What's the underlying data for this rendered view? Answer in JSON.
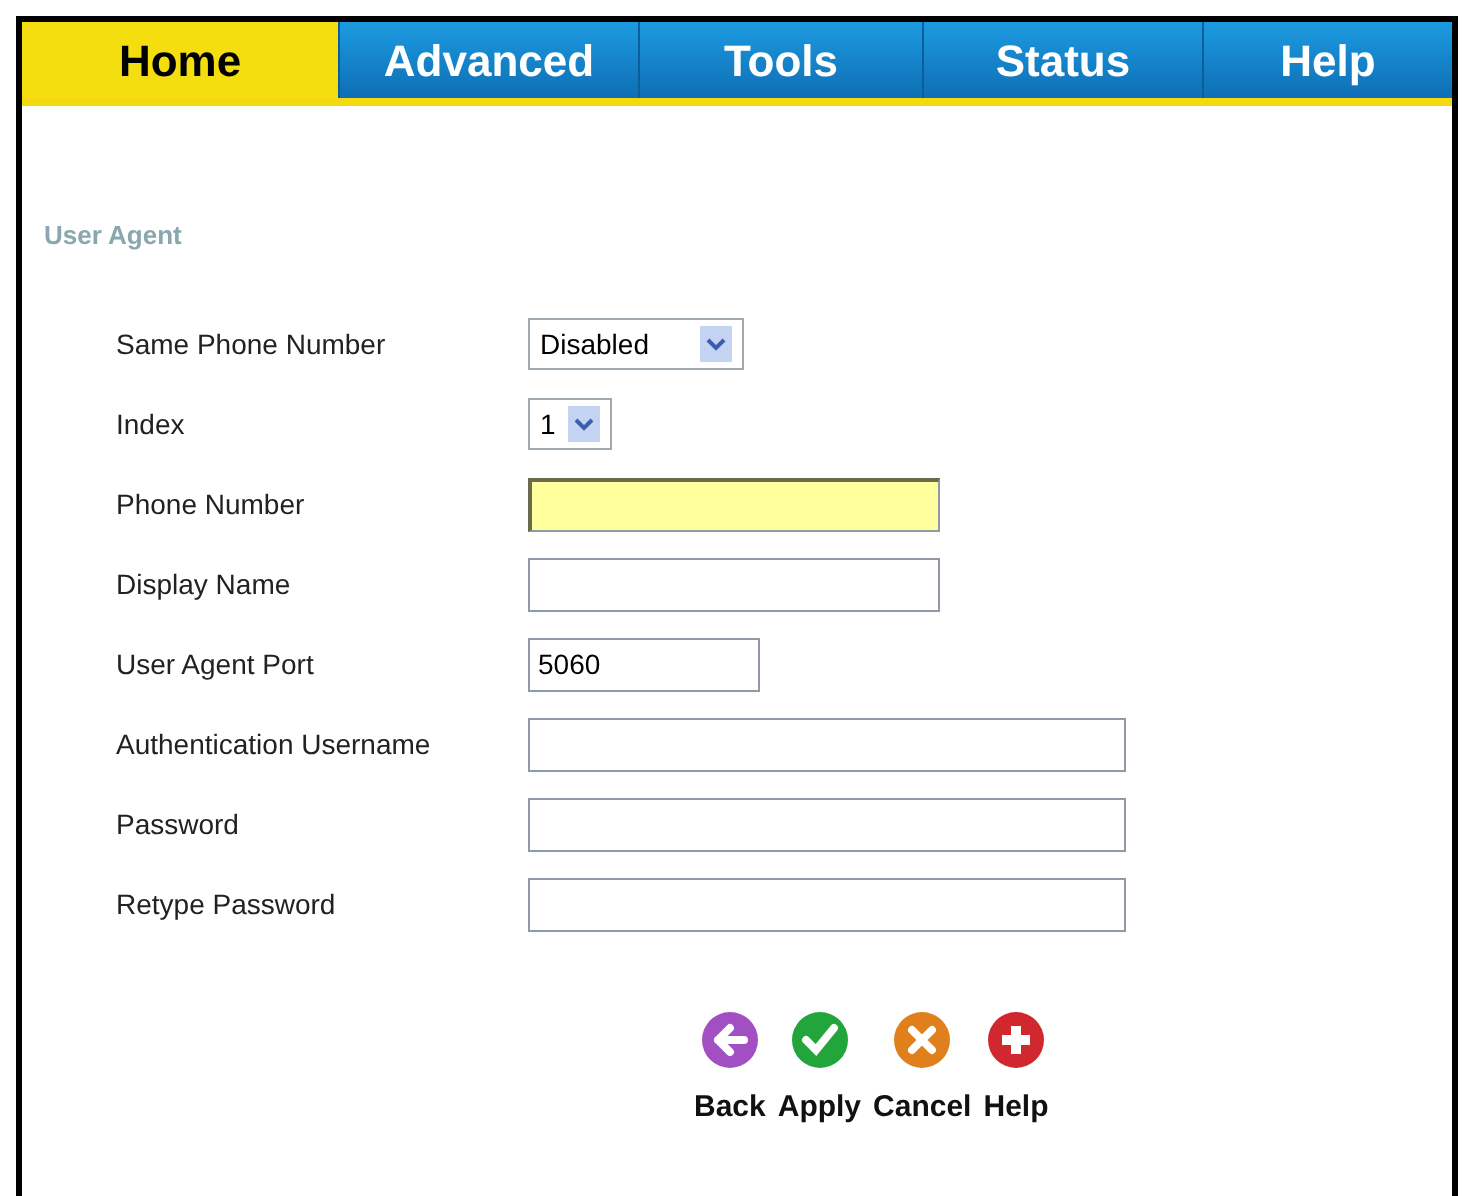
{
  "tabs": [
    {
      "label": "Home",
      "selected": true
    },
    {
      "label": "Advanced",
      "selected": false
    },
    {
      "label": "Tools",
      "selected": false
    },
    {
      "label": "Status",
      "selected": false
    },
    {
      "label": "Help",
      "selected": false
    }
  ],
  "section_title": "User Agent",
  "fields": [
    {
      "label": "Same Phone Number",
      "kind": "select",
      "value": "Disabled"
    },
    {
      "label": "Index",
      "kind": "select",
      "value": "1"
    },
    {
      "label": "Phone Number",
      "kind": "text",
      "highlighted": true
    },
    {
      "label": "Display Name",
      "kind": "text",
      "highlighted": false
    },
    {
      "label": "User Agent Port",
      "kind": "text",
      "value": "5060",
      "highlighted": false
    },
    {
      "label": "Authentication Username",
      "kind": "text",
      "highlighted": false
    },
    {
      "label": "Password",
      "kind": "text",
      "highlighted": false
    },
    {
      "label": "Retype Password",
      "kind": "text",
      "highlighted": false
    }
  ],
  "buttons": [
    {
      "label": "Back",
      "kind": "back"
    },
    {
      "label": "Apply",
      "kind": "apply"
    },
    {
      "label": "Cancel",
      "kind": "cancel"
    },
    {
      "label": "Help",
      "kind": "help"
    }
  ]
}
